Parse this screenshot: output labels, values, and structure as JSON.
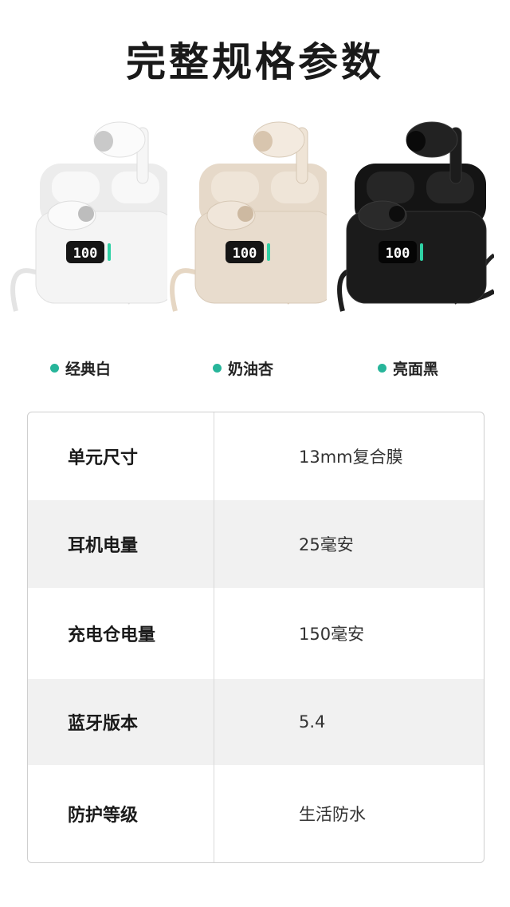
{
  "page_title": "完整规格参数",
  "products": [
    {
      "name": "经典白",
      "color": "#f4f4f4",
      "accent": "#ffffff",
      "display": "100"
    },
    {
      "name": "奶油杏",
      "color": "#e8dccd",
      "accent": "#f1e7da",
      "display": "100"
    },
    {
      "name": "亮面黑",
      "color": "#1a1a1a",
      "accent": "#2c2c2c",
      "display": "100"
    }
  ],
  "label_dot_color": "#27b59a",
  "specs": [
    {
      "key": "单元尺寸",
      "value": "13mm复合膜"
    },
    {
      "key": "耳机电量",
      "value": "25毫安"
    },
    {
      "key": "充电仓电量",
      "value": "150毫安"
    },
    {
      "key": "蓝牙版本",
      "value": "5.4"
    },
    {
      "key": "防护等级",
      "value": "生活防水"
    }
  ]
}
